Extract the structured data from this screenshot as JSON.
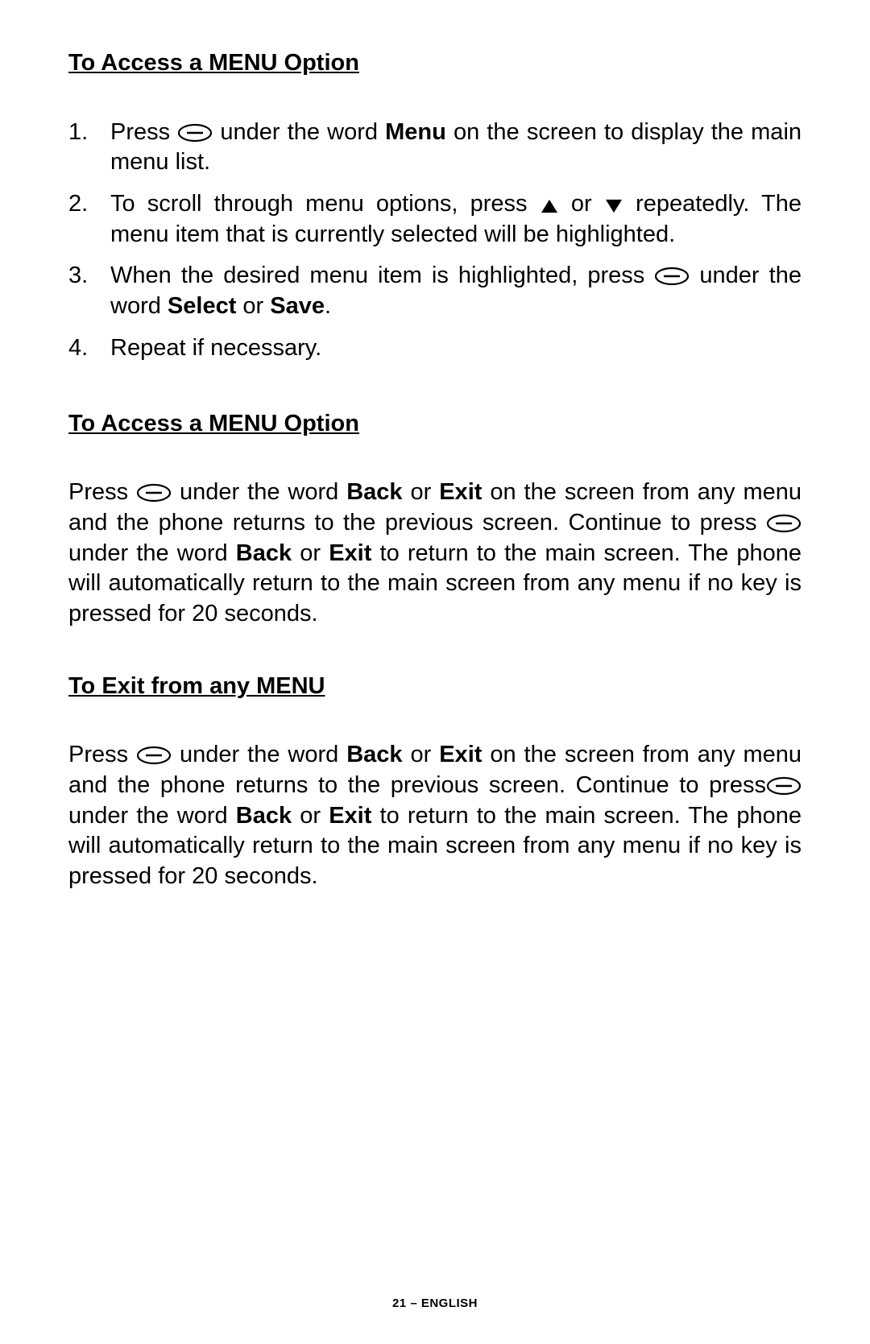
{
  "sections": {
    "s1": {
      "heading": "To Access a MENU Option",
      "items": {
        "i1": {
          "t1": "Press ",
          "t2": " under the word ",
          "b1": "Menu",
          "t3": " on the screen to display the main menu list."
        },
        "i2": {
          "t1": "To scroll through menu options, press ",
          "t2": " or ",
          "t3": " repeatedly. The menu item that is currently selected will be highlighted."
        },
        "i3": {
          "t1": "When the desired menu item is highlighted, press ",
          "t2": " under the word ",
          "b1": "Select",
          "t3": " or ",
          "b2": "Save",
          "t4": "."
        },
        "i4": {
          "t1": "Repeat if necessary."
        }
      }
    },
    "s2": {
      "heading": "To Access a MENU Option",
      "p": {
        "t1": "Press ",
        "t2": " under the word ",
        "b1": "Back",
        "t3": " or ",
        "b2": "Exit",
        "t4": " on the screen from any menu and the phone returns to the previous screen.  Continue to press ",
        "t5": " under the word ",
        "b3": "Back",
        "t6": " or ",
        "b4": "Exit",
        "t7": " to return to the main screen.  The phone will automatically return to the main screen from any menu if no key is pressed for 20 seconds."
      }
    },
    "s3": {
      "heading": "To Exit from any MENU",
      "p": {
        "t1": "Press ",
        "t2": " under the word ",
        "b1": "Back",
        "t3": " or ",
        "b2": "Exit",
        "t4": " on the screen from any menu and the phone returns to the previous screen. Continue to press",
        "t5": " under the word ",
        "b3": "Back",
        "t6": " or ",
        "b4": "Exit",
        "t7": " to return to the main screen.  The phone will automatically return to the main screen from any menu if no key is pressed for 20 seconds."
      }
    }
  },
  "footer": "21 – ENGLISH"
}
